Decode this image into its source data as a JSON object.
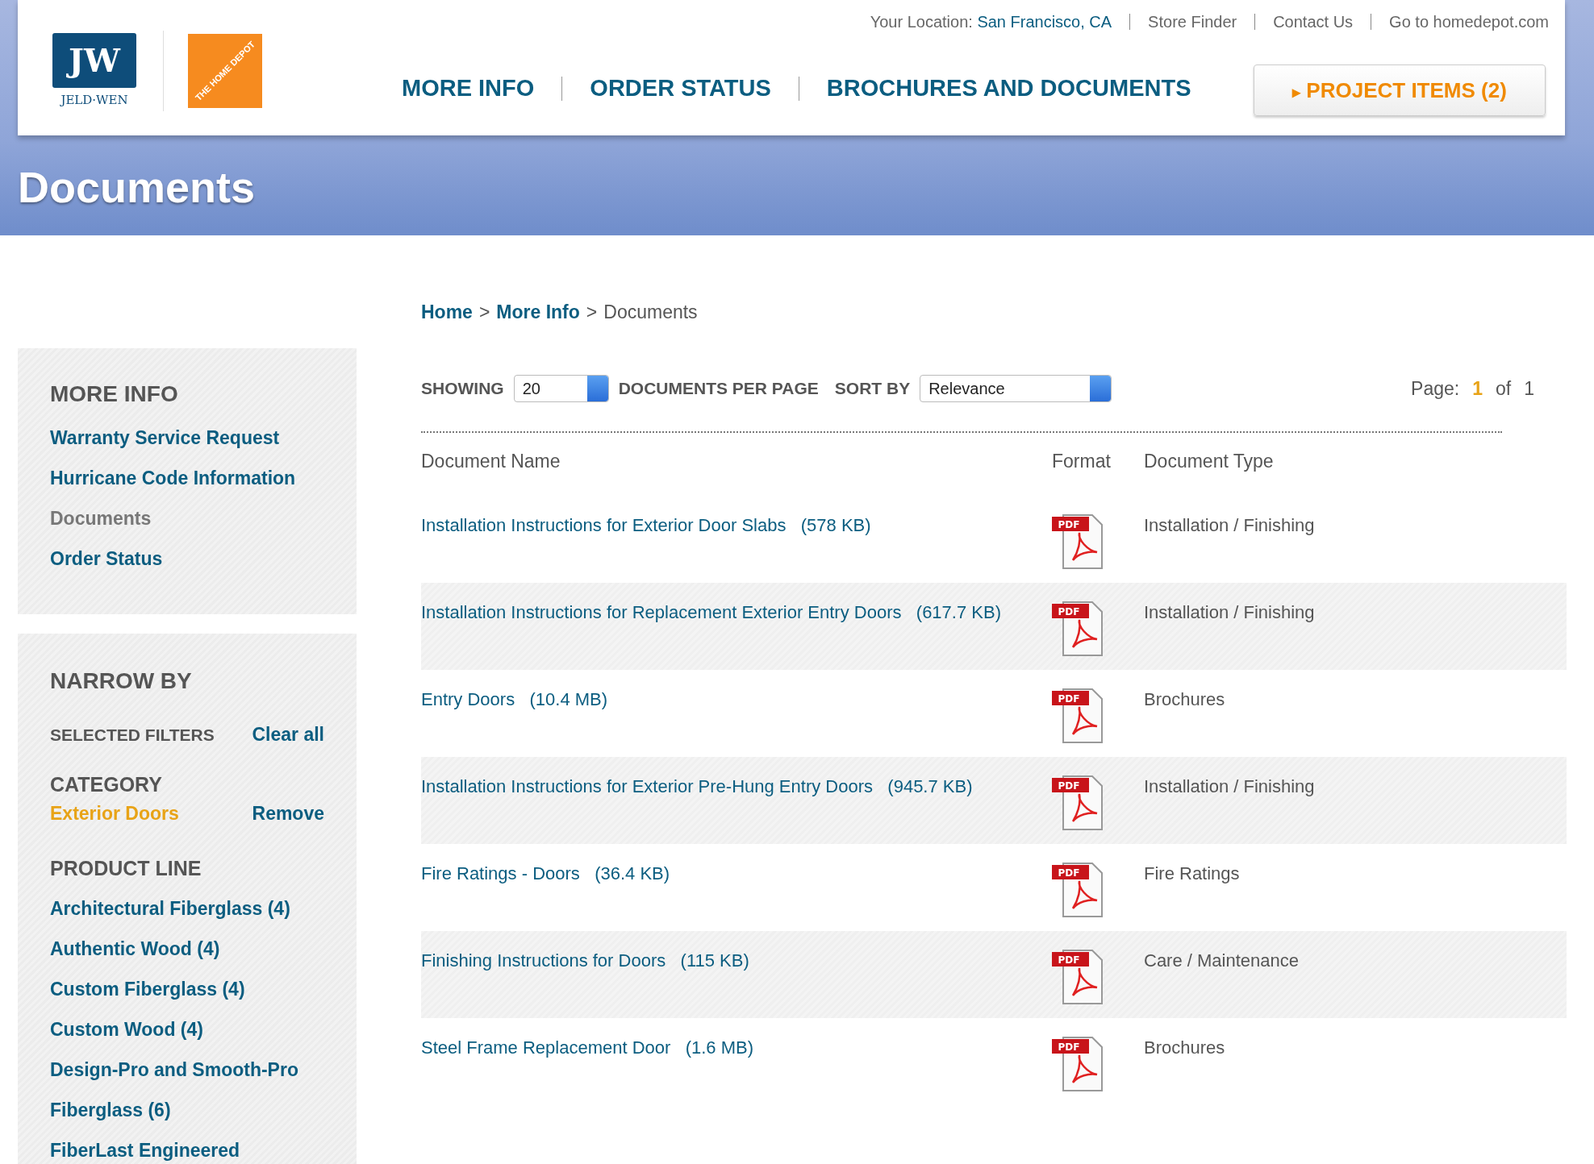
{
  "top_links": {
    "location_label": "Your Location:",
    "location": "San Francisco, CA",
    "links": [
      "Store Finder",
      "Contact Us",
      "Go to homedepot.com"
    ]
  },
  "logos": {
    "jeldwen_mark": "JW",
    "jeldwen_name": "JELD·WEN",
    "homedepot": "THE HOME DEPOT"
  },
  "nav": [
    {
      "label": "MORE INFO"
    },
    {
      "label": "ORDER STATUS"
    },
    {
      "label": "BROCHURES AND DOCUMENTS"
    }
  ],
  "project_button": {
    "icon": "▸",
    "label": "PROJECT ITEMS (2)"
  },
  "page_title": "Documents",
  "breadcrumb": [
    {
      "label": "Home",
      "link": true
    },
    {
      "label": "More Info",
      "link": true
    },
    {
      "label": "Documents",
      "link": false
    }
  ],
  "breadcrumb_separator": ">",
  "sidebar": {
    "more_info": {
      "title": "MORE INFO",
      "items": [
        {
          "label": "Warranty Service Request",
          "selected": false
        },
        {
          "label": "Hurricane Code Information",
          "selected": false
        },
        {
          "label": "Documents",
          "selected": true
        },
        {
          "label": "Order Status",
          "selected": false
        }
      ]
    },
    "narrow_by": {
      "title": "NARROW BY",
      "selected_filters_label": "SELECTED FILTERS",
      "clear_all": "Clear all",
      "category_label": "CATEGORY",
      "category_value": "Exterior Doors",
      "remove": "Remove",
      "product_line_label": "PRODUCT LINE",
      "product_lines": [
        "Architectural Fiberglass (4)",
        "Authentic Wood (4)",
        "Custom Fiberglass (4)",
        "Custom Wood (4)",
        "Design-Pro and Smooth-Pro",
        "Fiberglass (6)",
        "FiberLast Engineered"
      ]
    }
  },
  "toolbar": {
    "showing_label": "SHOWING",
    "per_page": "20",
    "per_page_label": "DOCUMENTS PER PAGE",
    "sort_label": "SORT BY",
    "sort_value": "Relevance",
    "page_label": "Page:",
    "page_current": "1",
    "page_of": "of",
    "page_total": "1"
  },
  "table": {
    "columns": [
      "Document Name",
      "Format",
      "Document Type"
    ],
    "rows": [
      {
        "name": "Installation Instructions for Exterior Door Slabs   (578 KB)",
        "format": "PDF",
        "type": "Installation / Finishing"
      },
      {
        "name": "Installation Instructions for Replacement Exterior Entry Doors   (617.7 KB)",
        "format": "PDF",
        "type": "Installation / Finishing"
      },
      {
        "name": "Entry Doors   (10.4 MB)",
        "format": "PDF",
        "type": "Brochures"
      },
      {
        "name": "Installation Instructions for Exterior Pre-Hung Entry Doors   (945.7 KB)",
        "format": "PDF",
        "type": "Installation / Finishing"
      },
      {
        "name": "Fire Ratings - Doors   (36.4 KB)",
        "format": "PDF",
        "type": "Fire Ratings"
      },
      {
        "name": "Finishing Instructions for Doors   (115 KB)",
        "format": "PDF",
        "type": "Care / Maintenance"
      },
      {
        "name": "Steel Frame Replacement Door   (1.6 MB)",
        "format": "PDF",
        "type": "Brochures"
      }
    ]
  }
}
